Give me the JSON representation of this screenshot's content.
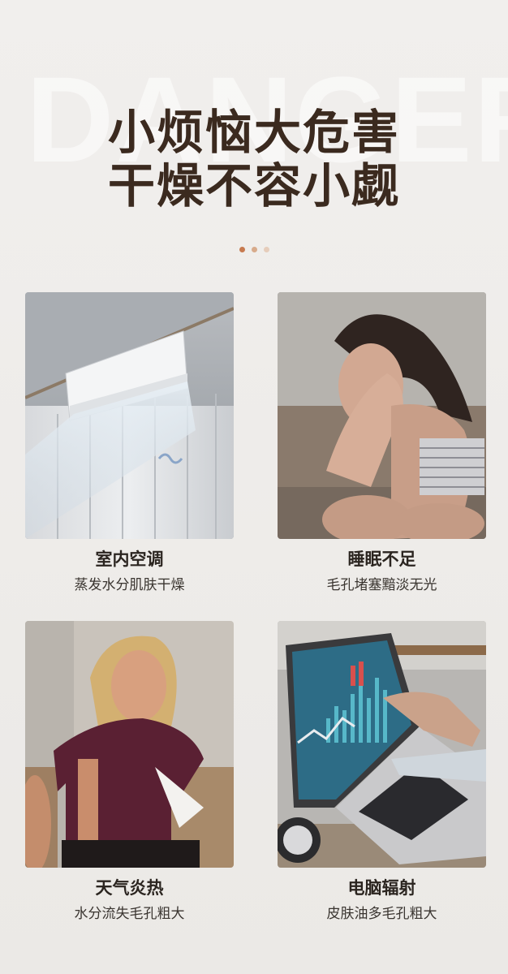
{
  "watermark": "DANGER",
  "headline": {
    "line1": "小烦恼大危害",
    "line2": "干燥不容小觑"
  },
  "pager": {
    "count": 3,
    "active": 1
  },
  "cards": [
    {
      "title": "室内空调",
      "desc": "蒸发水分肌肤干燥",
      "image": "air-conditioner-photo"
    },
    {
      "title": "睡眠不足",
      "desc": "毛孔堵塞黯淡无光",
      "image": "tired-woman-photo"
    },
    {
      "title": "天气炎热",
      "desc": "水分流失毛孔粗大",
      "image": "hot-weather-woman-photo"
    },
    {
      "title": "电脑辐射",
      "desc": "皮肤油多毛孔粗大",
      "image": "laptop-screen-photo"
    }
  ],
  "colors": {
    "accent": "#c77a4f",
    "headline": "#3b2a1f",
    "background": "#efedeb"
  }
}
